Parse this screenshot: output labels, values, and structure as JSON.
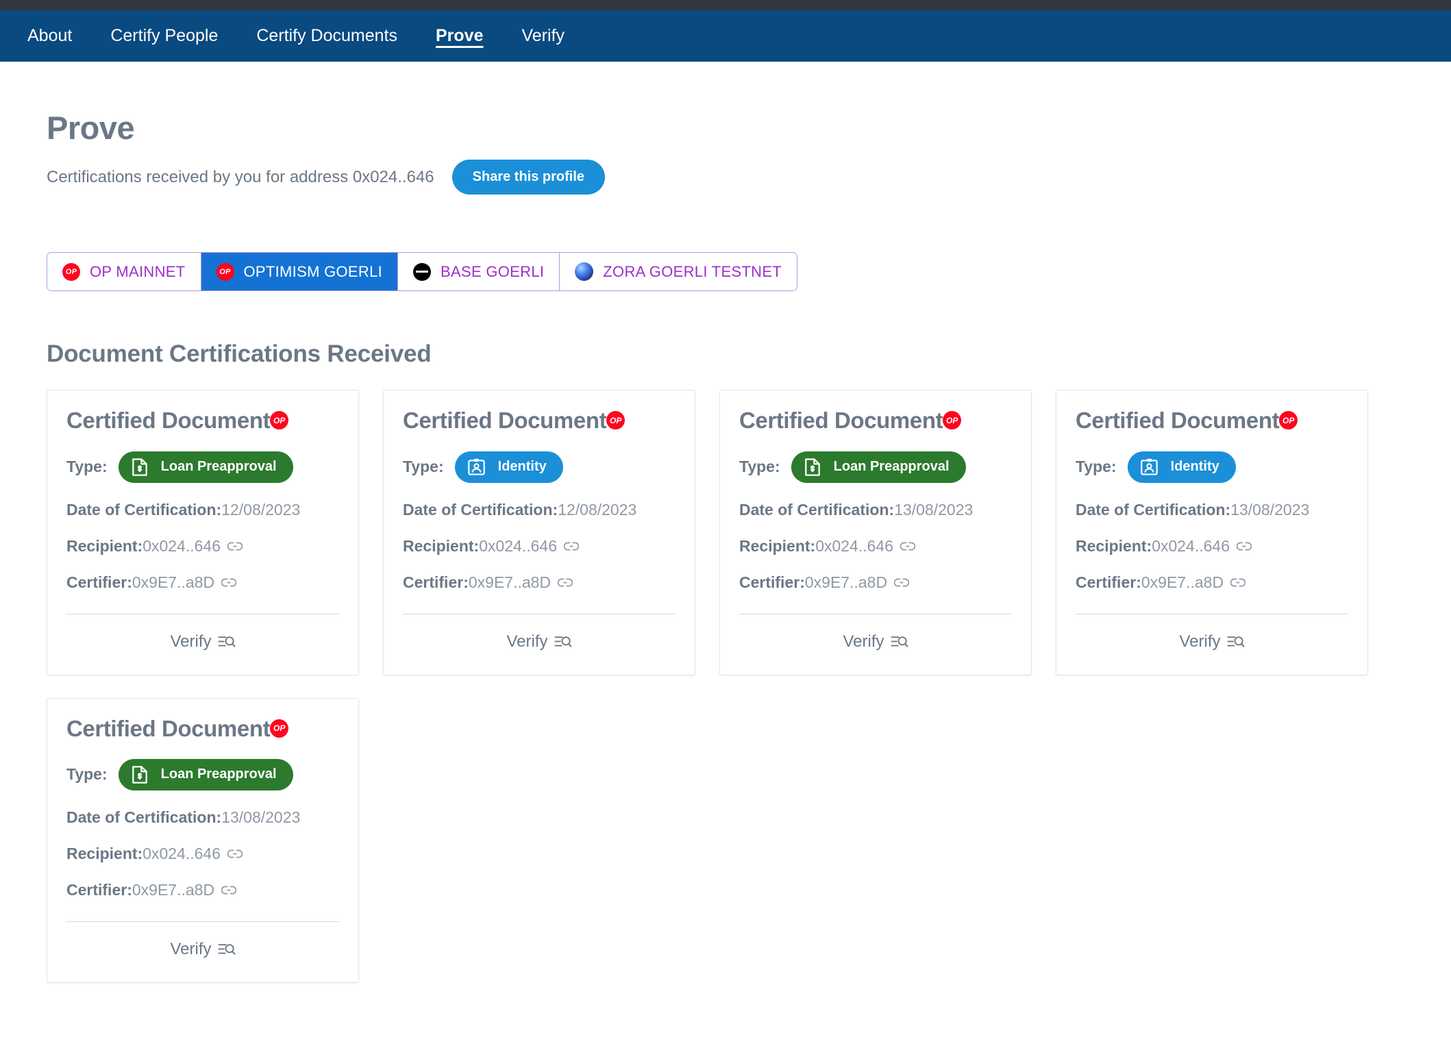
{
  "nav": {
    "items": [
      {
        "label": "About",
        "active": false
      },
      {
        "label": "Certify People",
        "active": false
      },
      {
        "label": "Certify Documents",
        "active": false
      },
      {
        "label": "Prove",
        "active": true
      },
      {
        "label": "Verify",
        "active": false
      }
    ]
  },
  "header": {
    "title": "Prove",
    "subtitle": "Certifications received by you for address 0x024..646",
    "share_button": "Share this profile",
    "share_button_color": "#1b8fd8"
  },
  "networks": {
    "chips": [
      {
        "label": "OP MAINNET",
        "icon": "op-icon",
        "icon_text": "OP",
        "active": false
      },
      {
        "label": "OPTIMISM GOERLI",
        "icon": "op-icon",
        "icon_text": "OP",
        "active": true
      },
      {
        "label": "BASE GOERLI",
        "icon": "base-icon",
        "icon_text": "",
        "active": false
      },
      {
        "label": "ZORA GOERLI TESTNET",
        "icon": "zora-icon",
        "icon_text": "",
        "active": false
      }
    ],
    "active_color": "#1472d4",
    "inactive_text_color": "#9b30c9"
  },
  "section": {
    "title": "Document Certifications Received"
  },
  "labels": {
    "type": "Type:",
    "date": "Date of Certification:",
    "recipient": "Recipient:",
    "certifier": "Certifier:",
    "verify": "Verify",
    "card_title": "Certified Document",
    "chain_badge": "OP"
  },
  "cards": [
    {
      "title": "Certified Document",
      "chain": "OP",
      "type": "Loan Preapproval",
      "type_style": "loan",
      "type_color": "#2c7a2e",
      "date": "12/08/2023",
      "recipient": "0x024..646",
      "certifier": "0x9E7..a8D",
      "verify": "Verify"
    },
    {
      "title": "Certified Document",
      "chain": "OP",
      "type": "Identity",
      "type_style": "identity",
      "type_color": "#1b8fd8",
      "date": "12/08/2023",
      "recipient": "0x024..646",
      "certifier": "0x9E7..a8D",
      "verify": "Verify"
    },
    {
      "title": "Certified Document",
      "chain": "OP",
      "type": "Loan Preapproval",
      "type_style": "loan",
      "type_color": "#2c7a2e",
      "date": "13/08/2023",
      "recipient": "0x024..646",
      "certifier": "0x9E7..a8D",
      "verify": "Verify"
    },
    {
      "title": "Certified Document",
      "chain": "OP",
      "type": "Identity",
      "type_style": "identity",
      "type_color": "#1b8fd8",
      "date": "13/08/2023",
      "recipient": "0x024..646",
      "certifier": "0x9E7..a8D",
      "verify": "Verify"
    },
    {
      "title": "Certified Document",
      "chain": "OP",
      "type": "Loan Preapproval",
      "type_style": "loan",
      "type_color": "#2c7a2e",
      "date": "13/08/2023",
      "recipient": "0x024..646",
      "certifier": "0x9E7..a8D",
      "verify": "Verify"
    }
  ]
}
